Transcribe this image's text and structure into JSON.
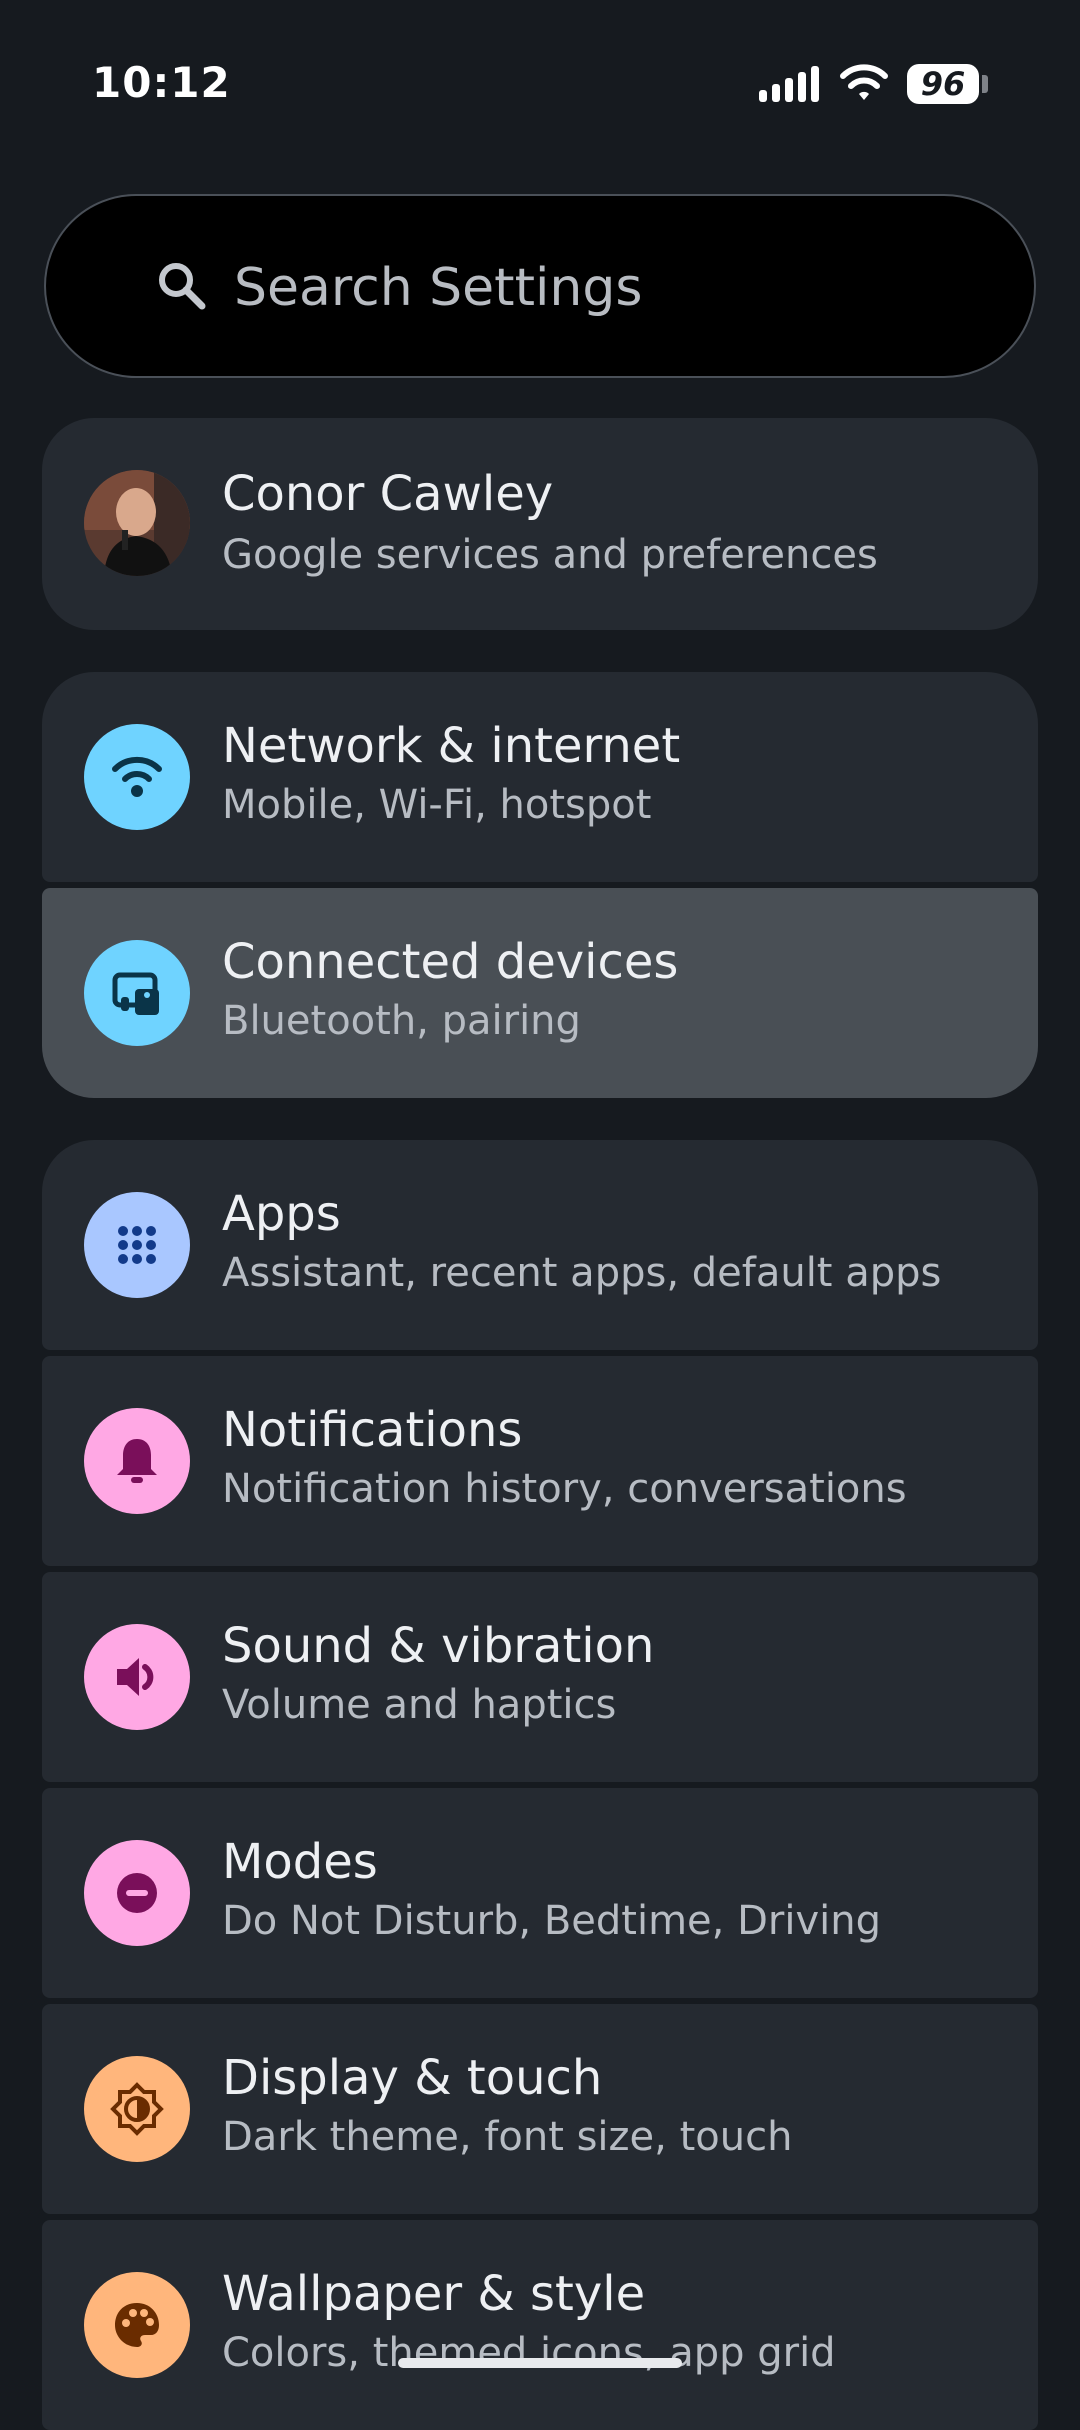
{
  "status_bar": {
    "time": "10:12",
    "battery": "96",
    "icons": [
      "signal-icon",
      "wifi-icon",
      "battery-icon"
    ]
  },
  "search": {
    "placeholder": "Search Settings"
  },
  "account": {
    "name": "Conor Cawley",
    "subtitle": "Google services and preferences"
  },
  "settings": [
    {
      "id": "network",
      "title": "Network & internet",
      "subtitle": "Mobile, Wi-Fi, hotspot",
      "icon": "wifi-icon",
      "color": "#6fd3ff"
    },
    {
      "id": "connected",
      "title": "Connected devices",
      "subtitle": "Bluetooth, pairing",
      "icon": "devices-icon",
      "color": "#6fd3ff"
    },
    {
      "id": "apps",
      "title": "Apps",
      "subtitle": "Assistant, recent apps, default apps",
      "icon": "apps-grid-icon",
      "color": "#a9c7ff"
    },
    {
      "id": "notifications",
      "title": "Notifications",
      "subtitle": "Notification history, conversations",
      "icon": "bell-icon",
      "color": "#ffa8e4"
    },
    {
      "id": "sound",
      "title": "Sound & vibration",
      "subtitle": "Volume and haptics",
      "icon": "speaker-icon",
      "color": "#ffa8e4"
    },
    {
      "id": "modes",
      "title": "Modes",
      "subtitle": "Do Not Disturb, Bedtime, Driving",
      "icon": "do-not-disturb-icon",
      "color": "#ffa8e4"
    },
    {
      "id": "display",
      "title": "Display & touch",
      "subtitle": "Dark theme, font size, touch",
      "icon": "brightness-icon",
      "color": "#ffb67c"
    },
    {
      "id": "wallpaper",
      "title": "Wallpaper & style",
      "subtitle": "Colors, themed icons, app grid",
      "icon": "palette-icon",
      "color": "#ffb67c"
    }
  ],
  "colors": {
    "background": "#161a1f",
    "card": "#252a31",
    "card_highlight": "#494f55",
    "accent_blue": "#6fd3ff",
    "accent_pink": "#ffa8e4",
    "accent_orange": "#ffb67c"
  }
}
